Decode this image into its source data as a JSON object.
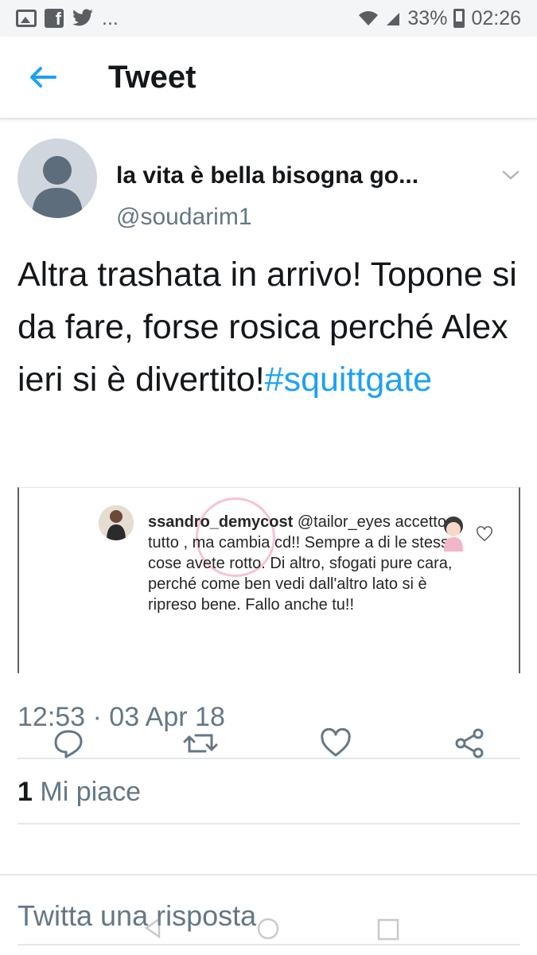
{
  "status_bar": {
    "left_icons": [
      "image-icon",
      "facebook-icon",
      "twitter-icon"
    ],
    "ellipsis": "...",
    "battery": "33%",
    "time": "02:26"
  },
  "header": {
    "back_icon": "arrow-left-icon",
    "title": "Tweet"
  },
  "tweet": {
    "author_name": "la vita è bella bisogna go...",
    "handle": "@soudarim1",
    "text_plain": "Altra trashata in arrivo! Topone si da fare, forse rosica perché Alex ieri si è divertito!",
    "hashtag": "#squittgate",
    "timestamp": "12:53 · 03 Apr 18",
    "likes_count": "1",
    "likes_label": "Mi piace"
  },
  "embedded_comment": {
    "username": "ssandro_demycost",
    "mention": "@tailor_eyes",
    "text": "accetto tutto , ma cambia cd!! Sempre a di le stesse cose avete rotto. Di altro, sfogati pure cara, perché come ben vedi dall'altro lato si è ripreso bene. Fallo anche tu!!"
  },
  "actions": [
    "reply-icon",
    "retweet-icon",
    "like-icon",
    "share-icon"
  ],
  "reply": {
    "placeholder": "Twitta una risposta"
  },
  "colors": {
    "accent": "#1da1f2",
    "secondary_text": "#657786",
    "primary_text": "#14171a"
  }
}
